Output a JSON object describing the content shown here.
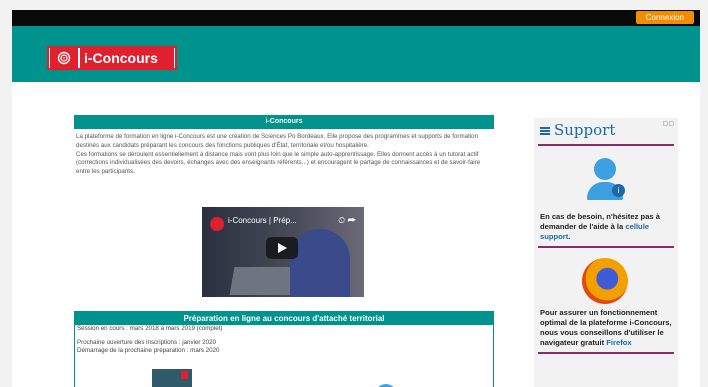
{
  "topbar": {
    "login_label": "Connexion"
  },
  "header": {
    "logo_text": "i-Concours"
  },
  "main": {
    "box1": {
      "title": "i-Concours",
      "paragraph1": "La plateforme de formation en ligne i-Concours est une création de Sciences Po Bordeaux. Elle propose des programmes et supports de formation destinés aux candidats préparant les concours des fonctions publiques d'État, territoriale et/ou hospitalière.",
      "paragraph2": "Ces formations se déroulent essentiellement à distance mais vont plus loin que le simple auto-apprentissage. Elles donnent accès à un tutorat actif (corrections individualisées des devoirs, échanges avec des enseignants référents...) et encouragent le partage de connaissances et de savoir-faire entre les participants.",
      "video_title": "i-Concours | Prép..."
    },
    "box2": {
      "title": "Préparation en ligne au concours d'attaché territorial",
      "session": "Session en cours : mars 2018 à mars 2019 (complet)",
      "opening": "Prochaine ouverture des inscriptions : janvier 2020",
      "start": "Démarrage de la prochaine préparation : mars 2020"
    }
  },
  "sidebar": {
    "title": "Support",
    "help_text": "En cas de besoin, n'hésitez pas à demander de l'aide à la",
    "help_link": "cellule support",
    "help_end": ".",
    "firefox_text": "Pour assurer un fonctionnement optimal de la plateforme i-Concours, nous vous conseillons d'utiliser le navigateur gratuit",
    "firefox_link": "Firefox"
  },
  "colors": {
    "teal": "#00938d",
    "orange": "#f28c00",
    "red": "#e0202e",
    "blue": "#1a6aa8",
    "purple": "#8a2c6a"
  }
}
